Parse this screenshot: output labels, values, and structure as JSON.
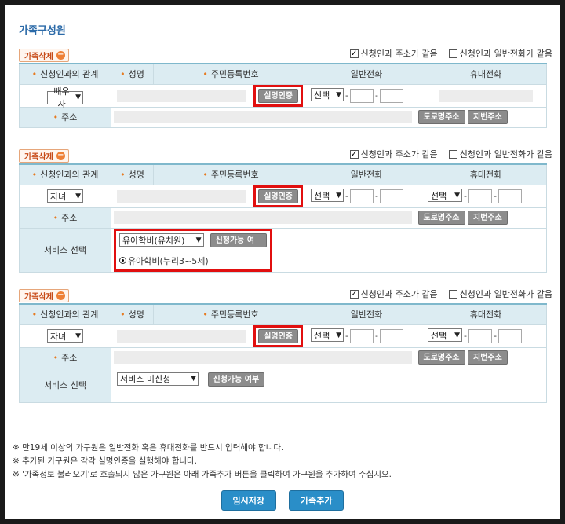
{
  "section_title": "가족구성원",
  "delete_label": "가족삭제",
  "checkbox_same_address": "신청인과 주소가 같음",
  "checkbox_same_phone": "신청인과 일반전화가 같음",
  "headers": {
    "relation": "신청인과의 관계",
    "name": "성명",
    "rrn": "주민등록번호",
    "phone": "일반전화",
    "mobile": "휴대전화",
    "address": "주소",
    "service": "서비스 선택"
  },
  "verify_button": "실명인증",
  "road_address_button": "도로명주소",
  "lot_address_button": "지번주소",
  "eligibility_button": "신청가능 여부",
  "phone_select": "선택",
  "dash": "-",
  "members": [
    {
      "relation": "배우자",
      "same_address_checked": "✓",
      "same_phone_checked": ""
    },
    {
      "relation": "자녀",
      "same_address_checked": "✓",
      "same_phone_checked": "",
      "service_select": "유아학비(유치원)",
      "service_radio": "유아학비(누리3~5세)"
    },
    {
      "relation": "자녀",
      "same_address_checked": "✓",
      "same_phone_checked": "",
      "service_select": "서비스 미신청"
    }
  ],
  "notes": [
    "※ 만19세 이상의 가구원은 일반전화 혹은 휴대전화를 반드시 입력해야 합니다.",
    "※ 추가된 가구원은 각각 실명인증을 실행해야 합니다.",
    "※ '가족정보 불러오기'로 호출되지 않은 가구원은 아래 가족추가 버튼을 클릭하여 가구원을 추가하여 주십시오."
  ],
  "temp_save_button": "임시저장",
  "add_family_button": "가족추가",
  "colors": {
    "accent": "#2a8ec8",
    "header_bg": "#dcecf2",
    "highlight": "#e10f0f"
  }
}
